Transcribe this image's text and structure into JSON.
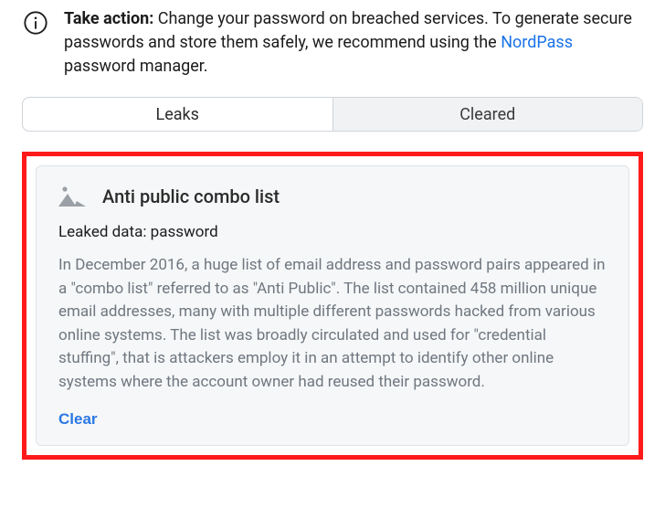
{
  "info": {
    "bold_label": "Take action:",
    "text_before_link": " Change your password on breached services. To generate secure passwords and store them safely, we recommend using the ",
    "link_text": "NordPass",
    "text_after_link": " password manager."
  },
  "tabs": {
    "leaks": "Leaks",
    "cleared": "Cleared"
  },
  "breach": {
    "title": "Anti public combo list",
    "leaked_label": "Leaked data:",
    "leaked_value": "password",
    "description": "In December 2016, a huge list of email address and password pairs appeared in a \"combo list\" referred to as \"Anti Public\". The list contained 458 million unique email addresses, many with multiple different passwords hacked from various online systems. The list was broadly circulated and used for \"credential stuffing\", that is attackers employ it in an attempt to identify other online systems where the account owner had reused their password.",
    "clear_label": "Clear"
  }
}
